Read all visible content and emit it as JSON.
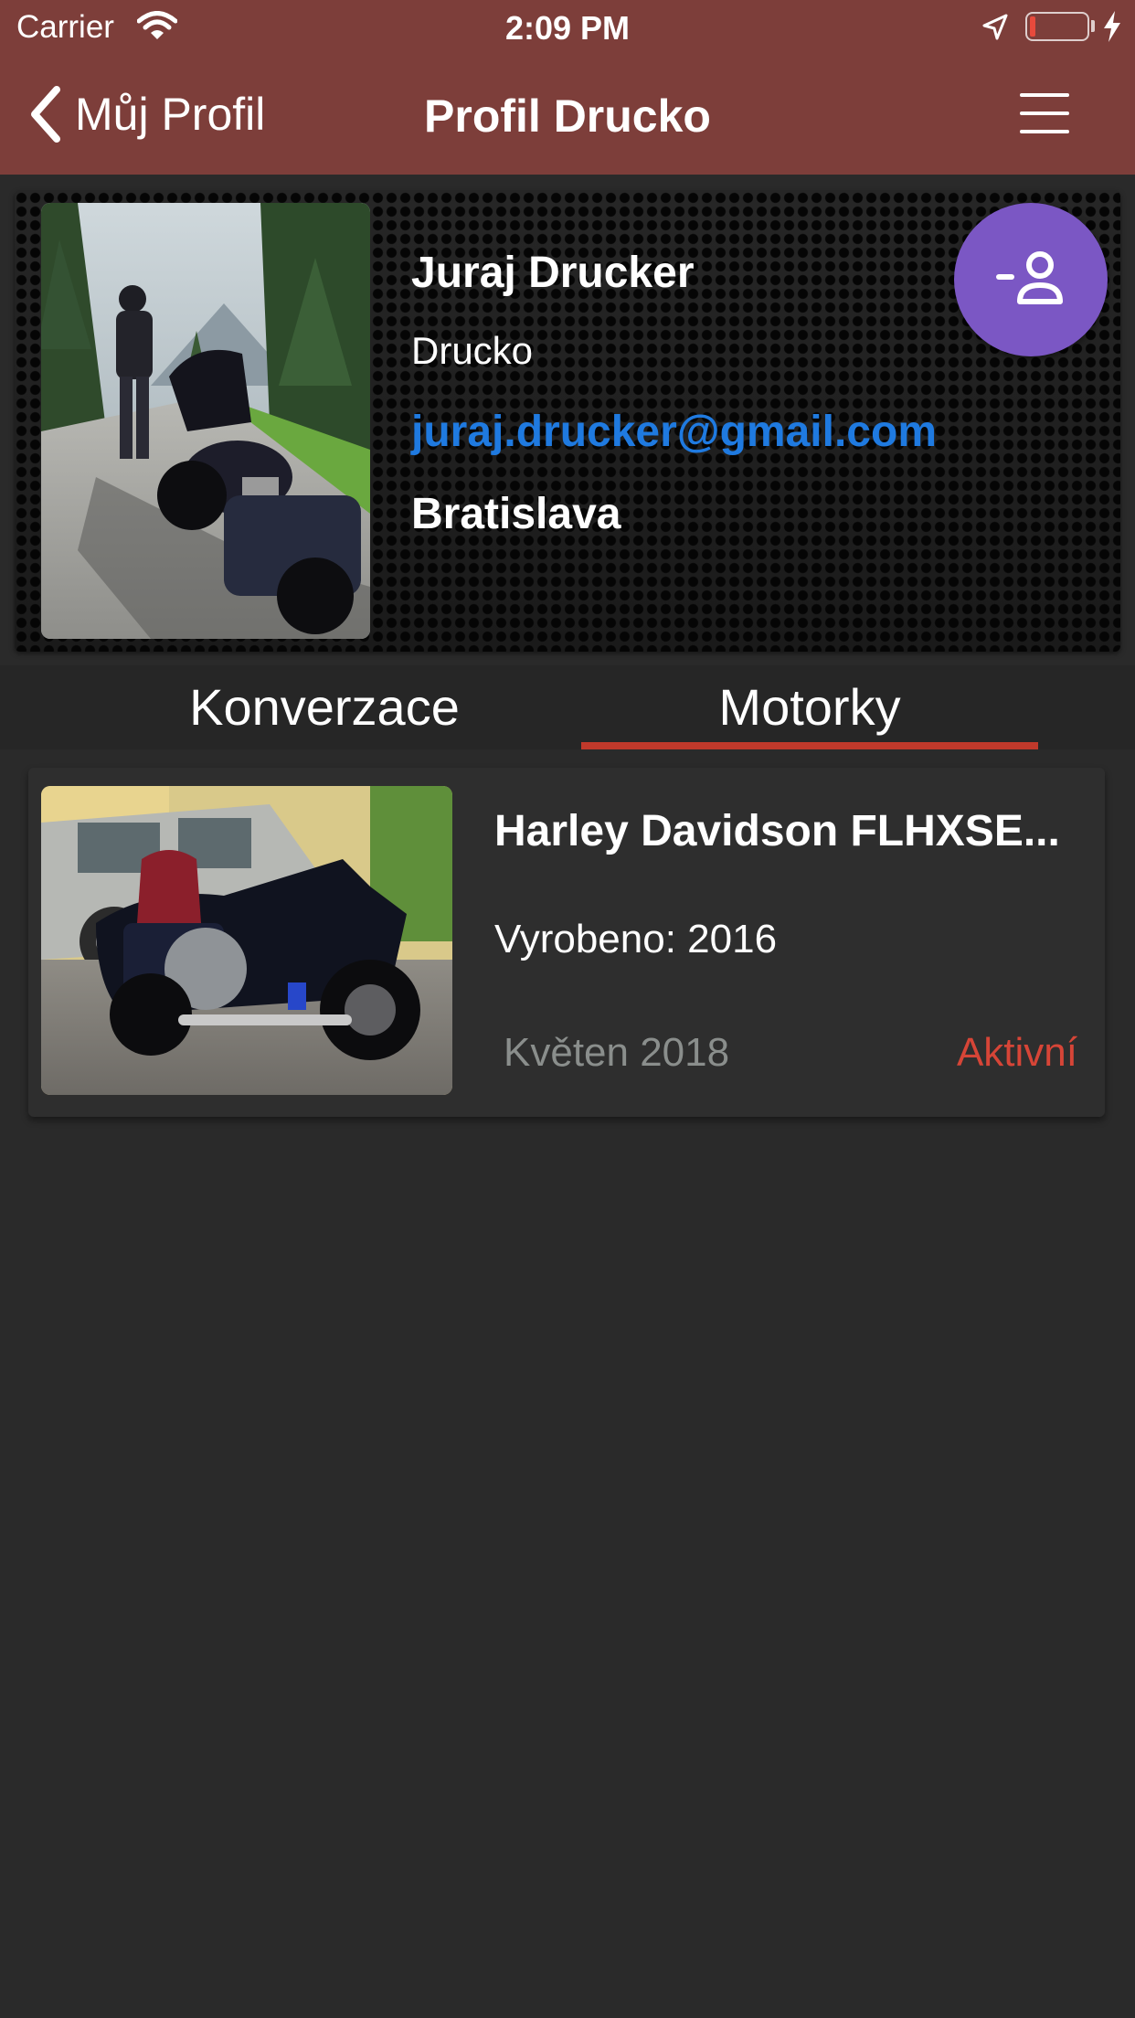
{
  "status_bar": {
    "carrier": "Carrier",
    "time": "2:09 PM",
    "icons": [
      "wifi-icon",
      "location-arrow-icon",
      "battery-icon",
      "charging-bolt-icon"
    ]
  },
  "nav": {
    "back_label": "Můj Profil",
    "title": "Profil Drucko",
    "menu_icon": "hamburger-menu-icon"
  },
  "profile": {
    "name": "Juraj Drucker",
    "nickname": "Drucko",
    "email": "juraj.drucker@gmail.com",
    "city": "Bratislava",
    "action_icon": "remove-friend-icon"
  },
  "tabs": [
    {
      "label": "Konverzace",
      "active": false
    },
    {
      "label": "Motorky",
      "active": true
    }
  ],
  "motorcycles": [
    {
      "title": "Harley Davidson FLHXSE...",
      "year_label": "Vyrobeno: ",
      "year": "2016",
      "date": "Květen 2018",
      "status": "Aktivní"
    }
  ],
  "colors": {
    "nav_background": "#7d3e3a",
    "page_background": "#2a2a2a",
    "email_link": "#1f7ae0",
    "action_button": "#7b57c4",
    "tab_indicator": "#c0392b",
    "status_active": "#d64537",
    "muted_text": "#8a8e8c"
  }
}
